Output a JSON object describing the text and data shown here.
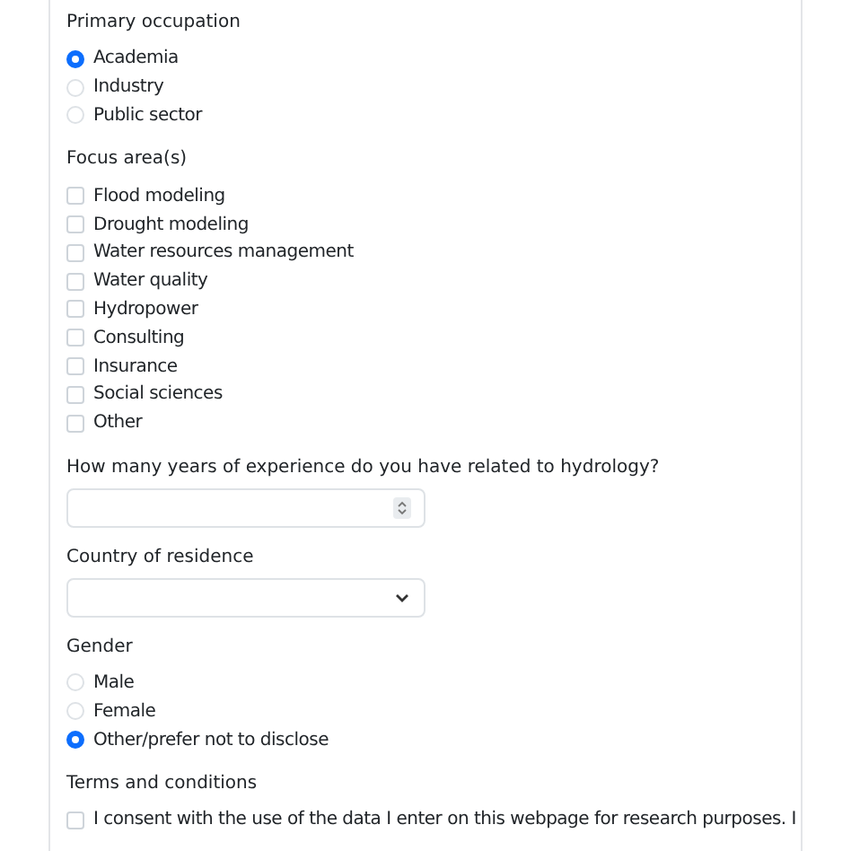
{
  "sections": [
    {
      "kind": "radio",
      "label": "Primary occupation",
      "options": [
        {
          "label": "Academia",
          "selected": true
        },
        {
          "label": "Industry",
          "selected": false
        },
        {
          "label": "Public sector",
          "selected": false
        }
      ]
    },
    {
      "kind": "checkbox",
      "label": "Focus area(s)",
      "options": [
        {
          "label": "Flood modeling",
          "checked": false
        },
        {
          "label": "Drought modeling",
          "checked": false
        },
        {
          "label": "Water resources management",
          "checked": false
        },
        {
          "label": "Water quality",
          "checked": false
        },
        {
          "label": "Hydropower",
          "checked": false
        },
        {
          "label": "Consulting",
          "checked": false
        },
        {
          "label": "Insurance",
          "checked": false
        },
        {
          "label": "Social sciences",
          "checked": false
        },
        {
          "label": "Other",
          "checked": false
        }
      ]
    },
    {
      "kind": "number",
      "label": "How many years of experience do you have related to hydrology?"
    },
    {
      "kind": "select",
      "label": "Country of residence"
    },
    {
      "kind": "radio",
      "label": "Gender",
      "options": [
        {
          "label": "Male",
          "selected": false
        },
        {
          "label": "Female",
          "selected": false
        },
        {
          "label": "Other/prefer not to disclose",
          "selected": true
        }
      ]
    },
    {
      "kind": "checkbox",
      "label": "Terms and conditions",
      "options": [
        {
          "label": "I consent with the use of the data I enter on this webpage for research purposes. I",
          "checked": false
        }
      ]
    }
  ]
}
